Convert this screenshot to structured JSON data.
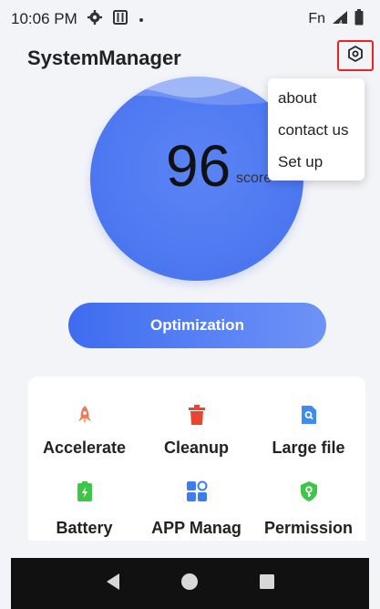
{
  "status_bar": {
    "time": "10:06 PM",
    "right_text": "Fn",
    "icons": [
      "gear-icon",
      "sim-card-icon",
      "dot-icon",
      "signal-icon",
      "battery-icon"
    ]
  },
  "app_bar": {
    "title": "SystemManager",
    "settings_icon": "hexagon-gear-icon"
  },
  "score": {
    "value": "96",
    "unit": "score"
  },
  "menu": {
    "items": [
      {
        "label": "about"
      },
      {
        "label": "contact us"
      },
      {
        "label": "Set up"
      }
    ]
  },
  "optimize_button": {
    "label": "Optimization"
  },
  "tools": [
    {
      "label": "Accelerate",
      "icon": "rocket-icon",
      "color": "#f0795a"
    },
    {
      "label": "Cleanup",
      "icon": "trash-icon",
      "color": "#e8462f"
    },
    {
      "label": "Large file",
      "icon": "search-file-icon",
      "color": "#3d8cf0"
    },
    {
      "label": "Battery",
      "icon": "battery-charge-icon",
      "color": "#3ec64a"
    },
    {
      "label": "APP Manag",
      "icon": "apps-grid-icon",
      "color": "#3d7cf0"
    },
    {
      "label": "Permission",
      "icon": "shield-key-icon",
      "color": "#3ec64a"
    }
  ],
  "nav_bar": {
    "icons": [
      "back-icon",
      "home-icon",
      "recents-icon"
    ]
  },
  "colors": {
    "accent": "#4e79f1",
    "highlight_border": "#e22222"
  }
}
